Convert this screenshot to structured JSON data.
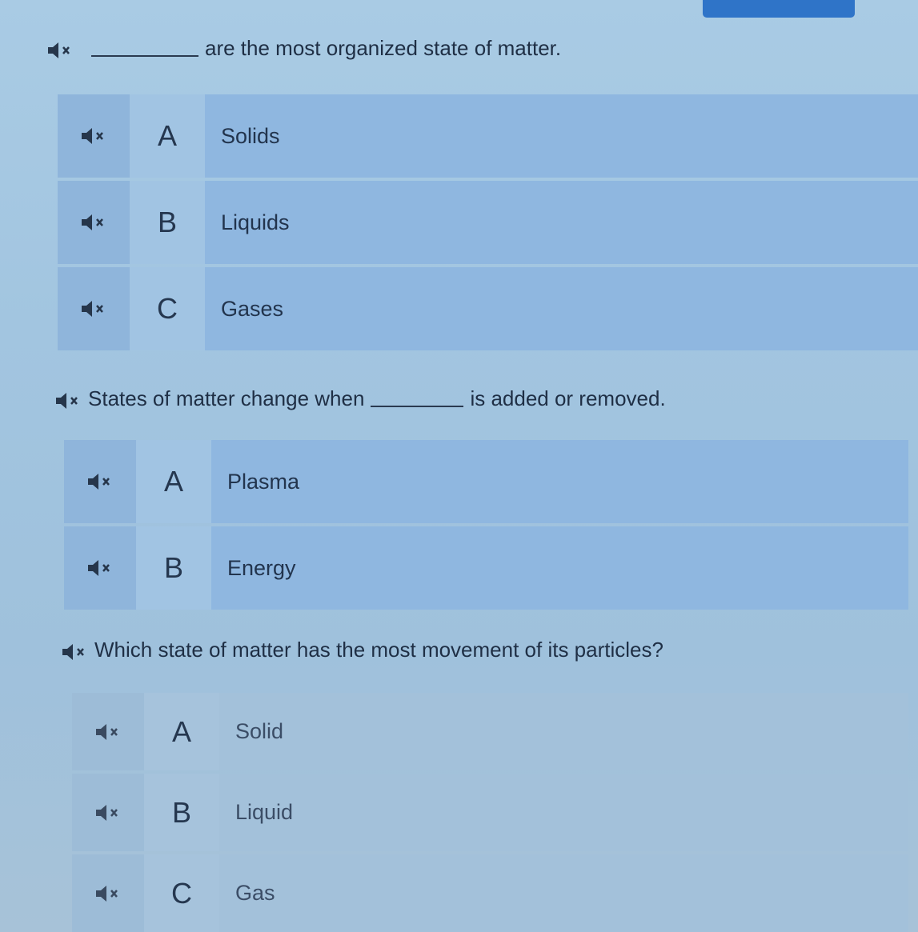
{
  "questions": [
    {
      "prefix": "",
      "suffix": "are the most organized state of matter.",
      "answers": [
        {
          "letter": "A",
          "text": "Solids"
        },
        {
          "letter": "B",
          "text": "Liquids"
        },
        {
          "letter": "C",
          "text": "Gases"
        }
      ]
    },
    {
      "prefix": "States of matter change when",
      "suffix": "is added or removed.",
      "answers": [
        {
          "letter": "A",
          "text": "Plasma"
        },
        {
          "letter": "B",
          "text": "Energy"
        }
      ]
    },
    {
      "prefix": "Which state of matter has the most movement of its particles?",
      "suffix": "",
      "answers": [
        {
          "letter": "A",
          "text": "Solid"
        },
        {
          "letter": "B",
          "text": "Liquid"
        },
        {
          "letter": "C",
          "text": "Gas"
        }
      ]
    }
  ],
  "icons": {
    "speaker": "speaker-muted-icon"
  },
  "colors": {
    "top_button": "#2f74c8",
    "answer_cell": "#8fb7e0"
  }
}
